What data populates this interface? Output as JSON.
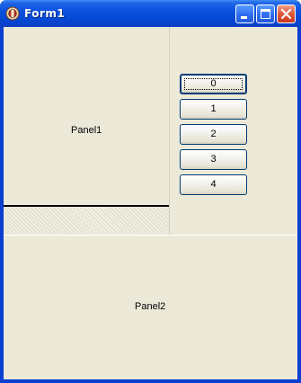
{
  "window": {
    "title": "Form1",
    "controls": [
      "minimize-icon",
      "maximize-icon",
      "close-icon"
    ]
  },
  "panel1": {
    "label": "Panel1"
  },
  "panel2": {
    "label": "Panel2"
  },
  "buttons": [
    {
      "label": "0"
    },
    {
      "label": "1"
    },
    {
      "label": "2"
    },
    {
      "label": "3"
    },
    {
      "label": "4"
    }
  ],
  "colors": {
    "titlebar": "#0548d4",
    "face": "#ece9d8",
    "close_button": "#e0573a",
    "button_border": "#003c74"
  }
}
